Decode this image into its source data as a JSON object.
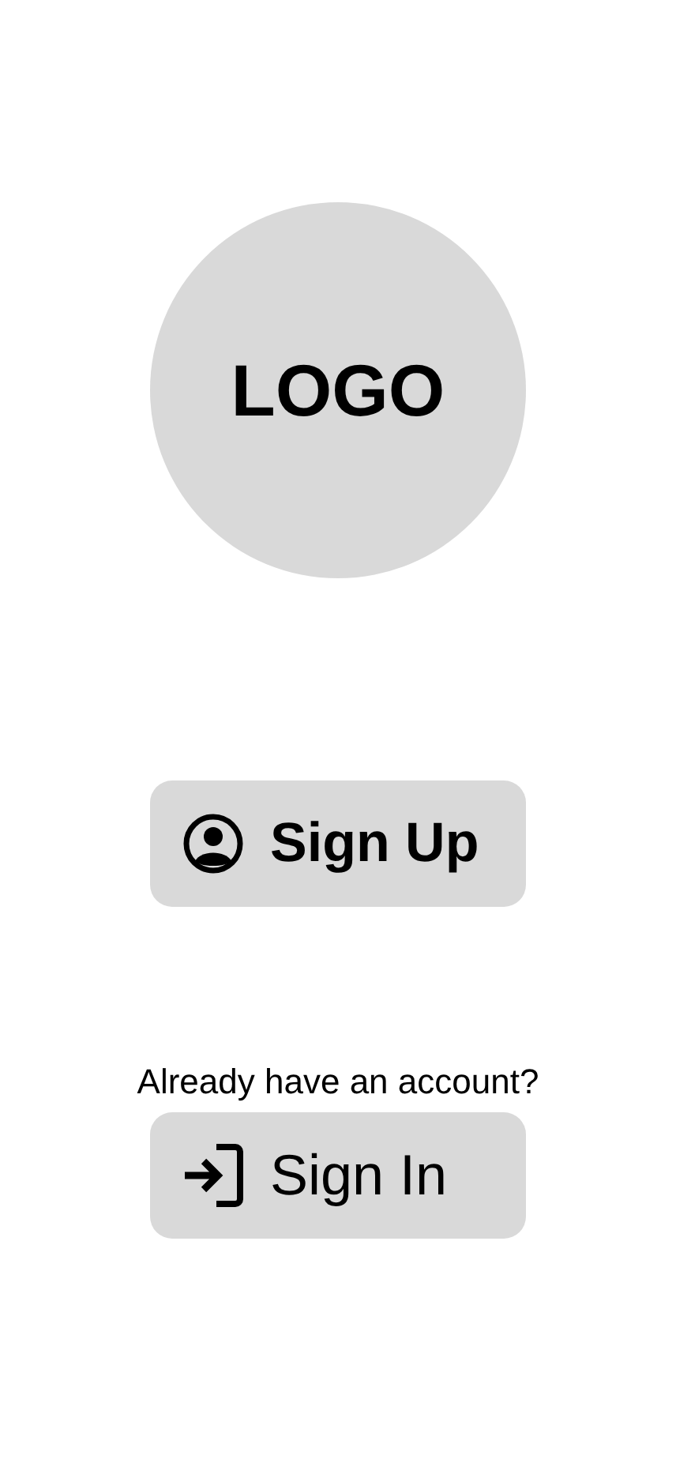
{
  "logo": {
    "text": "LOGO"
  },
  "sign_up_button": {
    "label": "Sign Up"
  },
  "prompt": "Already have an account?",
  "sign_in_button": {
    "label": "Sign In"
  }
}
